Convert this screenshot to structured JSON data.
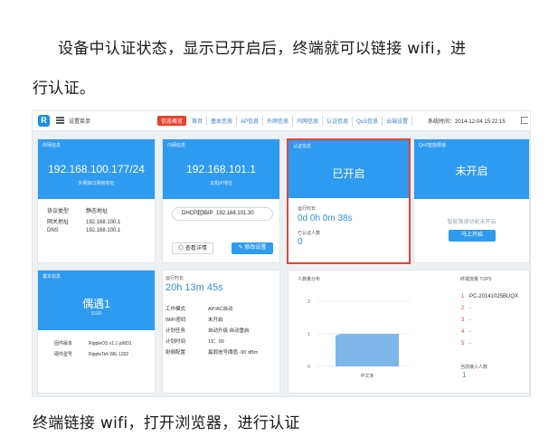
{
  "doc": {
    "p1a": "设备中认证状态，显示已开启后，终端就可以链接 wifi，进",
    "p1b": "行认证。",
    "p2": "终端链接 wifi，打开浏览器，进行认证"
  },
  "screenshot": {
    "topbar": {
      "logo_letter": "R",
      "app_title": "设置菜单",
      "nav": [
        "信息概览",
        "首页",
        "基本信息",
        "AP信息",
        "外网信息",
        "内网信息",
        "认证信息",
        "QoS信息",
        "云端设置"
      ],
      "active_index": 0,
      "system_time_label": "系统时间：",
      "system_time": "2014-12-04 15:22:15"
    },
    "wan_card": {
      "label": "外网信息",
      "ip": "192.168.100.177/24",
      "sub": "外网接口网络地址",
      "rows": [
        {
          "k": "协议类型",
          "v": "静态地址"
        },
        {
          "k": "网关地址",
          "v": "192.168.100.1"
        },
        {
          "k": "DNS",
          "v": "192.168.100.1"
        }
      ]
    },
    "lan_card": {
      "label": "内网信息",
      "ip": "192.168.101.1",
      "sub": "本机IP地址",
      "dhcp_label": "DHCP起始IP",
      "dhcp_value": "192.168.101.30",
      "btn_view": "查看详情",
      "btn_edit": "修改设置"
    },
    "auth_card": {
      "label": "认证信息",
      "status": "已开启",
      "runtime_label": "运行时长",
      "runtime": "0d 0h 0m 38s",
      "count_label": "已认证人数",
      "count": "0"
    },
    "qos_card": {
      "label": "QoS智能限速",
      "status": "未开启",
      "hint": "智能限速功能未开启",
      "btn": "马上开始"
    },
    "basic_card": {
      "label": "基本信息",
      "name": "偶遇1",
      "sub": "SSID",
      "rows": [
        {
          "k": "固件版本",
          "v": "RippleOS v1.1 p9831"
        },
        {
          "k": "硬件型号",
          "v": "RippleTek WE-1202"
        }
      ]
    },
    "runtime_card": {
      "label": "运行时长",
      "value": "20h 13m 45s",
      "rows": [
        {
          "k": "工作模式",
          "v": "AP/AC自动"
        },
        {
          "k": "WIFI密码",
          "v": "未开启"
        },
        {
          "k": "计划任务",
          "v": "自动升级  自动重启"
        },
        {
          "k": "计划时间",
          "v": "19：00"
        },
        {
          "k": "射频配置",
          "v": "最弱信号阈值 -90 dBm"
        }
      ]
    },
    "chart_card": {
      "title": "人数量分布",
      "xlabel": "中文未",
      "chart_data": {
        "type": "area",
        "title": "人数量分布",
        "yticks": [
          0,
          1,
          2
        ],
        "ylim": [
          0,
          2
        ],
        "categories": [
          "中文未"
        ],
        "values": [
          1
        ],
        "color": "#7fb7ea"
      }
    },
    "top_card": {
      "title": "终端流量 TOP5",
      "items": [
        {
          "rank": "1",
          "name": "PC-20141025BUQX"
        },
        {
          "rank": "2",
          "name": "-"
        },
        {
          "rank": "3",
          "name": "-"
        },
        {
          "rank": "4",
          "name": "-"
        },
        {
          "rank": "5",
          "name": "-"
        }
      ],
      "online_label": "当前接入人数",
      "online_value": "1"
    }
  }
}
